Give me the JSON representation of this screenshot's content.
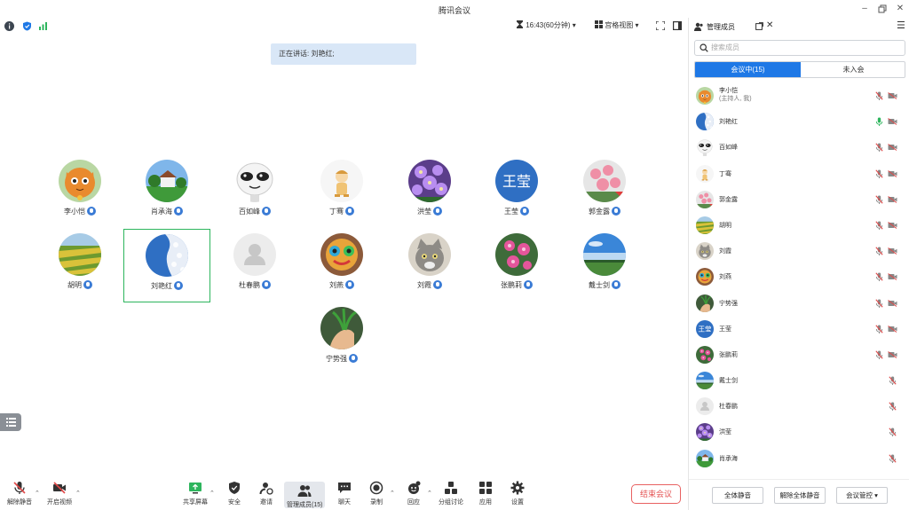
{
  "window": {
    "title": "腾讯会议",
    "controls": [
      "minimize",
      "restore",
      "close"
    ]
  },
  "infobar": {
    "time": "16:43(60分钟)",
    "view_label": "宫格视图"
  },
  "stage": {
    "speaking": "正在讲话: 刘艳红;",
    "tiles": [
      {
        "name": "李小恺",
        "avatar": "cartoon-cat"
      },
      {
        "name": "肖承海",
        "avatar": "house-landscape"
      },
      {
        "name": "百如峰",
        "avatar": "sticker-face"
      },
      {
        "name": "丁骞",
        "avatar": "cartoon-figure"
      },
      {
        "name": "洪莹",
        "avatar": "purple-flowers"
      },
      {
        "name": "王莹",
        "avatar": "text-avatar",
        "text": "王莹"
      },
      {
        "name": "郭金露",
        "avatar": "pink-flowers"
      },
      {
        "name": "胡明",
        "avatar": "fields"
      },
      {
        "name": "刘艳红",
        "avatar": "blossom-sky",
        "speaking": true
      },
      {
        "name": "杜春鹏",
        "avatar": "default-person"
      },
      {
        "name": "刘燕",
        "avatar": "colorful-toy"
      },
      {
        "name": "刘霞",
        "avatar": "gray-cat"
      },
      {
        "name": "张鹏莉",
        "avatar": "flower-bush"
      },
      {
        "name": "戴士剑",
        "avatar": "sky-lake"
      },
      {
        "name": "宁势强",
        "avatar": "hand-plant"
      }
    ]
  },
  "toolbar": {
    "unmute": "解除静音",
    "start_video": "开启视频",
    "share": "共享屏幕",
    "security": "安全",
    "invite": "邀请",
    "members": "管理成员(15)",
    "chat": "聊天",
    "record": "录制",
    "reaction": "回应",
    "breakout": "分组讨论",
    "apps": "应用",
    "settings": "设置",
    "end": "结束会议"
  },
  "panel": {
    "title": "管理成员",
    "search_placeholder": "搜索成员",
    "tab_in": "会议中(15)",
    "tab_out": "未入会",
    "members": [
      {
        "name": "李小恺",
        "sub": "(主持人, 我)",
        "mic": "muted",
        "video": "off",
        "avatar": "cartoon-cat"
      },
      {
        "name": "刘艳红",
        "mic": "active",
        "video": "off",
        "avatar": "blossom-sky"
      },
      {
        "name": "百如峰",
        "mic": "muted",
        "video": "off",
        "avatar": "sticker-face"
      },
      {
        "name": "丁骞",
        "mic": "muted",
        "video": "off",
        "avatar": "cartoon-figure"
      },
      {
        "name": "郭金露",
        "mic": "muted",
        "video": "off",
        "avatar": "pink-flowers"
      },
      {
        "name": "胡明",
        "mic": "muted",
        "video": "off",
        "avatar": "fields"
      },
      {
        "name": "刘霞",
        "mic": "muted",
        "video": "off",
        "avatar": "gray-cat"
      },
      {
        "name": "刘燕",
        "mic": "muted",
        "video": "off",
        "avatar": "colorful-toy"
      },
      {
        "name": "宁势强",
        "mic": "muted",
        "video": "off",
        "avatar": "hand-plant"
      },
      {
        "name": "王莹",
        "mic": "muted",
        "video": "off",
        "avatar": "text-avatar",
        "text": "王莹"
      },
      {
        "name": "张鹏莉",
        "mic": "muted",
        "video": "off",
        "avatar": "flower-bush"
      },
      {
        "name": "戴士剑",
        "mic": "muted",
        "avatar": "sky-lake"
      },
      {
        "name": "杜春鹏",
        "mic": "muted",
        "avatar": "default-person"
      },
      {
        "name": "洪莹",
        "mic": "muted",
        "avatar": "purple-flowers"
      },
      {
        "name": "肖承海",
        "mic": "muted",
        "avatar": "house-landscape"
      }
    ],
    "mute_all": "全体静音",
    "unmute_all": "解除全体静音",
    "meeting_control": "会议管控"
  },
  "colors": {
    "accent": "#1e78e6",
    "end_red": "#e45454",
    "active_border": "#2db55d"
  }
}
